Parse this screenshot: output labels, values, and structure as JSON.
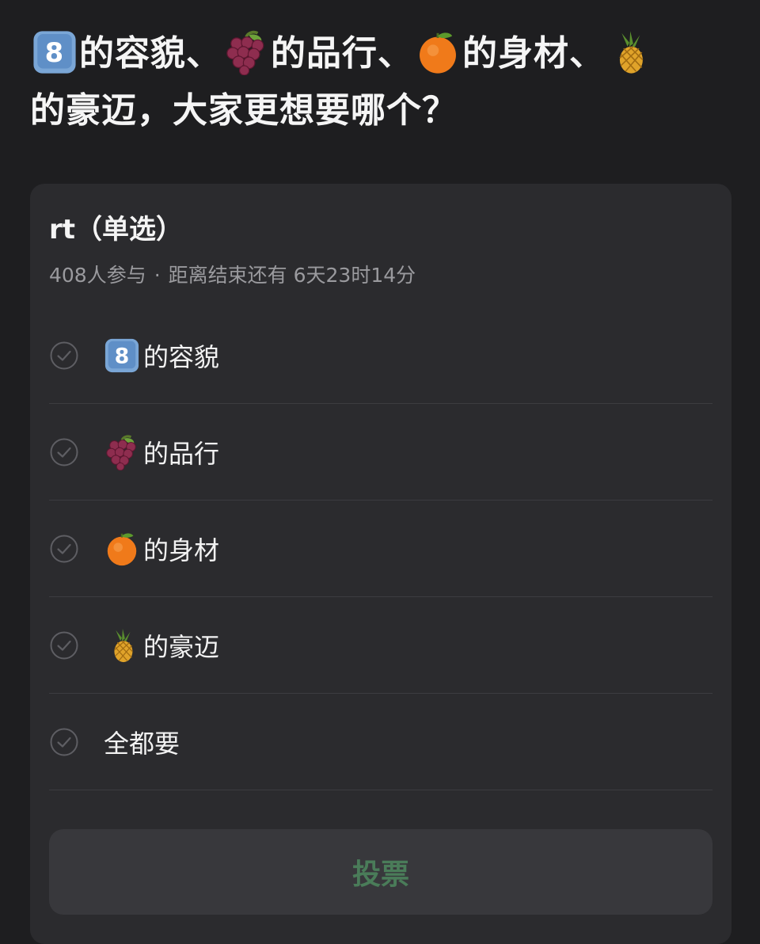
{
  "headline": {
    "icons": [
      "keycap-8-icon",
      "grapes-icon",
      "tangerine-icon",
      "pineapple-icon"
    ],
    "part1": "的容貌、",
    "part2": "的品行、",
    "part3": "的身材、",
    "part4": "的豪迈，大家更想要哪个？"
  },
  "poll": {
    "title": "rt（单选）",
    "participants": "408人参与",
    "separator": "·",
    "countdown": "距离结束还有 6天23时14分",
    "options": [
      {
        "icon": "keycap-8-icon",
        "label": "的容貌"
      },
      {
        "icon": "grapes-icon",
        "label": "的品行"
      },
      {
        "icon": "tangerine-icon",
        "label": "的身材"
      },
      {
        "icon": "pineapple-icon",
        "label": "的豪迈"
      },
      {
        "icon": "",
        "label": "全都要"
      }
    ],
    "vote_label": "投票"
  },
  "colors": {
    "background": "#1e1e20",
    "card": "#2b2b2e",
    "vote_text": "#4a7c59",
    "muted_text": "#9a9a9e"
  }
}
